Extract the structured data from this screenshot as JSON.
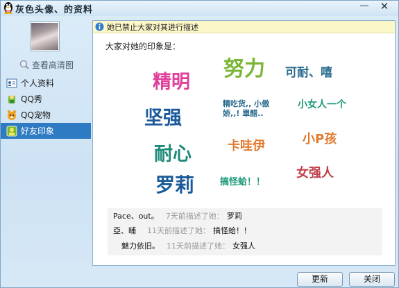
{
  "window": {
    "title": "灰色头像、的资料",
    "minimize_glyph": "—",
    "close_glyph": "✕"
  },
  "sidebar": {
    "avatar_icon": "avatar-photo",
    "view_hd_label": "查看高清图",
    "items": [
      {
        "label": "个人资料",
        "icon": "profile-card-icon",
        "active": false
      },
      {
        "label": "QQ秀",
        "icon": "qq-show-icon",
        "active": false
      },
      {
        "label": "QQ宠物",
        "icon": "qq-pet-icon",
        "active": false
      },
      {
        "label": "好友印象",
        "icon": "friend-impression-icon",
        "active": true
      }
    ]
  },
  "notice": {
    "icon": "info-icon",
    "text": "她已禁止大家对其进行描述"
  },
  "impressions": {
    "intro": "大家对她的印象是：",
    "tags": [
      {
        "text": "精明",
        "color": "#e0409a"
      },
      {
        "text": "努力",
        "color": "#7ab536"
      },
      {
        "text": "可耐、嘻",
        "color": "#2a6b8f"
      },
      {
        "text": "坚强",
        "color": "#1a5a9a"
      },
      {
        "text": "精吃货,, 小傲娇,,! 單醋..",
        "color": "#2a6b8f"
      },
      {
        "text": "小女人一个",
        "color": "#1e9a7a"
      },
      {
        "text": "卡哇伊",
        "color": "#e07a30"
      },
      {
        "text": "小P孩",
        "color": "#e07a30"
      },
      {
        "text": "耐心",
        "color": "#1e8a7a"
      },
      {
        "text": "罗莉",
        "color": "#1a5a9a"
      },
      {
        "text": "搞怪蛤！！",
        "color": "#1e9a7a"
      },
      {
        "text": "女强人",
        "color": "#c0404a"
      }
    ]
  },
  "descriptions": [
    {
      "who": "Pace、out。",
      "when": "7天前描述了她：",
      "what": "罗莉"
    },
    {
      "who": "亞、晡",
      "when": "11天前描述了她：",
      "what": "搞怪蛤！！"
    },
    {
      "who": "魅力依旧。",
      "when": "11天前描述了她：",
      "what": "女强人"
    }
  ],
  "buttons": {
    "update": "更新",
    "close": "关闭"
  },
  "colors": {
    "active_nav": "#2e7bc3",
    "notice_bg": "#fbf7c8"
  }
}
